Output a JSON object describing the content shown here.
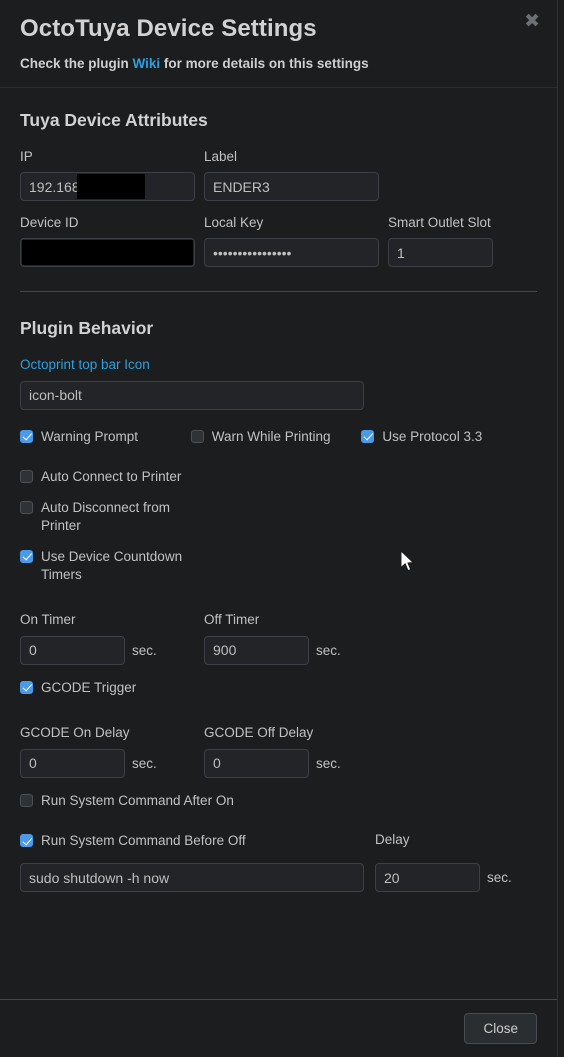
{
  "window": {
    "title": "OctoTuya Device Settings",
    "subtitle_before": "Check the plugin ",
    "subtitle_link": "Wiki",
    "subtitle_after": " for more details on this settings",
    "close_icon": "close-icon",
    "close_glyph": "✖"
  },
  "sections": {
    "attributes": {
      "title": "Tuya Device Attributes",
      "ip": {
        "label": "IP",
        "value": "192.168",
        "redacted": true
      },
      "label_field": {
        "label": "Label",
        "value": "ENDER3"
      },
      "device_id": {
        "label": "Device ID",
        "value": "",
        "redacted": true
      },
      "local_key": {
        "label": "Local Key",
        "value": "••••••••••••••••"
      },
      "smart_outlet_slot": {
        "label": "Smart Outlet Slot",
        "value": "1"
      }
    },
    "behavior": {
      "title": "Plugin Behavior",
      "topbar_icon": {
        "label": "Octoprint top bar Icon",
        "value": "icon-bolt"
      },
      "checkboxes": {
        "warning_prompt": {
          "label": "Warning Prompt",
          "checked": true
        },
        "warn_while_printing": {
          "label": "Warn While Printing",
          "checked": false
        },
        "use_protocol_33": {
          "label": "Use Protocol 3.3",
          "checked": true
        },
        "auto_connect": {
          "label": "Auto Connect to Printer",
          "checked": false
        },
        "auto_disconnect": {
          "label": "Auto Disconnect from Printer",
          "checked": false
        },
        "use_countdown_timers": {
          "label": "Use Device Countdown Timers",
          "checked": true
        },
        "gcode_trigger": {
          "label": "GCODE Trigger",
          "checked": true
        },
        "run_cmd_after_on": {
          "label": "Run System Command After On",
          "checked": false
        },
        "run_cmd_before_off": {
          "label": "Run System Command Before Off",
          "checked": true
        }
      },
      "on_timer": {
        "label": "On Timer",
        "value": "0",
        "suffix": "sec."
      },
      "off_timer": {
        "label": "Off Timer",
        "value": "900",
        "suffix": "sec."
      },
      "gcode_on_delay": {
        "label": "GCODE On Delay",
        "value": "0",
        "suffix": "sec."
      },
      "gcode_off_delay": {
        "label": "GCODE Off Delay",
        "value": "0",
        "suffix": "sec."
      },
      "system_command": {
        "value": "sudo shutdown -h now"
      },
      "command_delay": {
        "label": "Delay",
        "value": "20",
        "suffix": "sec."
      }
    }
  },
  "footer": {
    "close_button": "Close"
  },
  "colors": {
    "accent": "#2f9fe0",
    "checkbox_on": "#4a9ae8",
    "background": "#1b1d1f",
    "input_background": "#222427"
  }
}
